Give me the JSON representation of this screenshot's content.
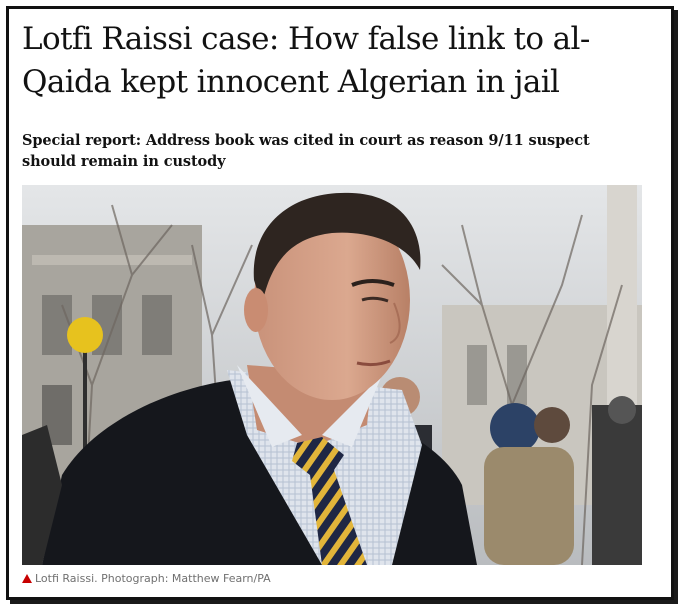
{
  "article": {
    "headline": "Lotfi Raissi case: How false link to al-Qaida kept innocent Algerian in jail",
    "standfirst": "Special report: Address book was cited in court as reason 9/11 suspect should remain in custody",
    "caption": "Lotfi Raissi. Photograph: Matthew Fearn/PA",
    "caption_icon": "triangle-icon"
  },
  "colors": {
    "text": "#121212",
    "caption_text": "#707070",
    "caption_icon": "#c70000"
  }
}
